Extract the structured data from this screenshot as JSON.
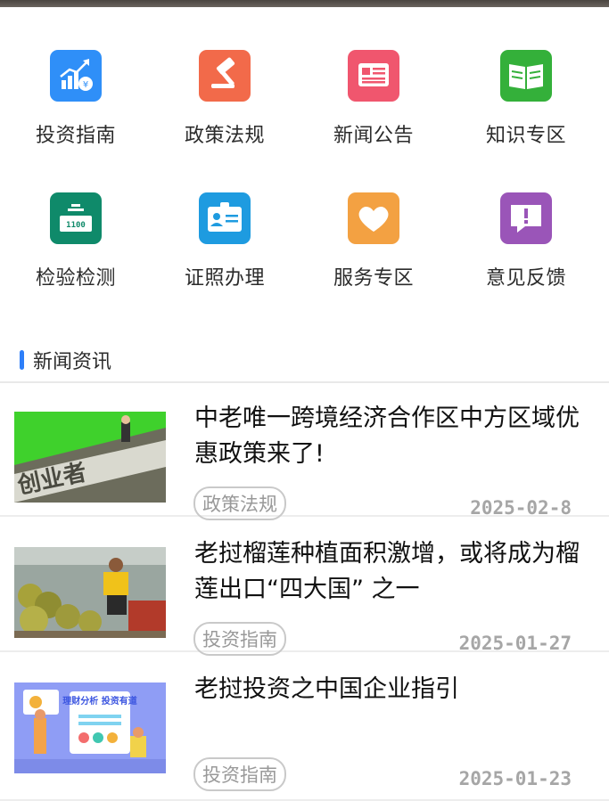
{
  "categories": [
    {
      "label": "投资指南",
      "icon": "chart-growth-icon",
      "color": "#2f8ff8"
    },
    {
      "label": "政策法规",
      "icon": "gavel-icon",
      "color": "#f26a4a"
    },
    {
      "label": "新闻公告",
      "icon": "newspaper-icon",
      "color": "#f0566e"
    },
    {
      "label": "知识专区",
      "icon": "open-book-icon",
      "color": "#34b03a"
    },
    {
      "label": "检验检测",
      "icon": "scale-icon",
      "color": "#0f8a6a"
    },
    {
      "label": "证照办理",
      "icon": "id-card-icon",
      "color": "#1e9be0"
    },
    {
      "label": "服务专区",
      "icon": "heart-icon",
      "color": "#f3a142"
    },
    {
      "label": "意见反馈",
      "icon": "feedback-bubble-icon",
      "color": "#9a55b8"
    }
  ],
  "section": {
    "title": "新闻资讯",
    "accent": "#2d7ff9"
  },
  "news": [
    {
      "title": "中老唯一跨境经济合作区中方区域优惠政策来了!",
      "tag": "政策法规",
      "date": "2025-02-8",
      "thumb_text": "创业者"
    },
    {
      "title": "老挝榴莲种植面积激增，或将成为榴莲出口“四大国” 之一",
      "tag": "投资指南",
      "date": "2025-01-27"
    },
    {
      "title": "老挝投资之中国企业指引",
      "tag": "投资指南",
      "date": "2025-01-23",
      "thumb_text": "理财分析 投资有道"
    }
  ]
}
